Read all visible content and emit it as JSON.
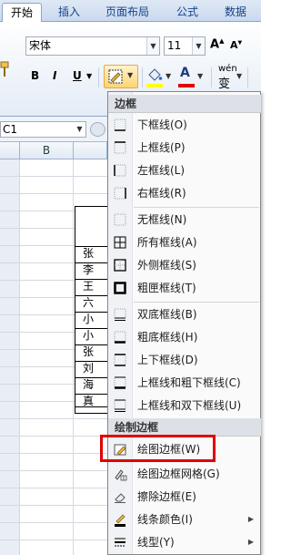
{
  "tabs": [
    "开始",
    "插入",
    "页面布局",
    "公式",
    "数据"
  ],
  "font": {
    "name": "宋体",
    "size": "11",
    "grow": "A",
    "shrink": "A"
  },
  "format": {
    "bold": "B",
    "italic": "I",
    "underline": "U",
    "font_color_glyph": "A",
    "wen_top": "wén",
    "wen_bottom": "变"
  },
  "name_box": "C1",
  "columns": [
    "B"
  ],
  "table_rows": [
    "张",
    "李",
    "王",
    "六",
    "小",
    "小",
    "张",
    "刘",
    "海",
    "真"
  ],
  "menu": {
    "header_borders": "边框",
    "items": [
      {
        "label": "下框线(O)",
        "icon": "bottom-border-icon"
      },
      {
        "label": "上框线(P)",
        "icon": "top-border-icon"
      },
      {
        "label": "左框线(L)",
        "icon": "left-border-icon"
      },
      {
        "label": "右框线(R)",
        "icon": "right-border-icon"
      },
      {
        "label": "无框线(N)",
        "icon": "no-border-icon"
      },
      {
        "label": "所有框线(A)",
        "icon": "all-borders-icon"
      },
      {
        "label": "外侧框线(S)",
        "icon": "outside-borders-icon"
      },
      {
        "label": "粗匣框线(T)",
        "icon": "thick-box-border-icon"
      },
      {
        "label": "双底框线(B)",
        "icon": "double-bottom-border-icon"
      },
      {
        "label": "粗底框线(H)",
        "icon": "thick-bottom-border-icon"
      },
      {
        "label": "上下框线(D)",
        "icon": "top-bottom-border-icon"
      },
      {
        "label": "上框线和粗下框线(C)",
        "icon": "top-thick-bottom-border-icon"
      },
      {
        "label": "上框线和双下框线(U)",
        "icon": "top-double-bottom-border-icon"
      }
    ],
    "header_draw": "绘制边框",
    "draw_items": [
      {
        "label": "绘图边框(W)",
        "icon": "draw-border-icon"
      },
      {
        "label": "绘图边框网格(G)",
        "icon": "draw-border-grid-icon"
      },
      {
        "label": "擦除边框(E)",
        "icon": "erase-border-icon"
      },
      {
        "label": "线条颜色(I)",
        "icon": "line-color-icon"
      },
      {
        "label": "线型(Y)",
        "icon": "line-style-icon"
      }
    ]
  },
  "colors": {
    "accent_highlight": "#e00000",
    "fill_color": "#ffff00",
    "font_color": "#e00000"
  }
}
